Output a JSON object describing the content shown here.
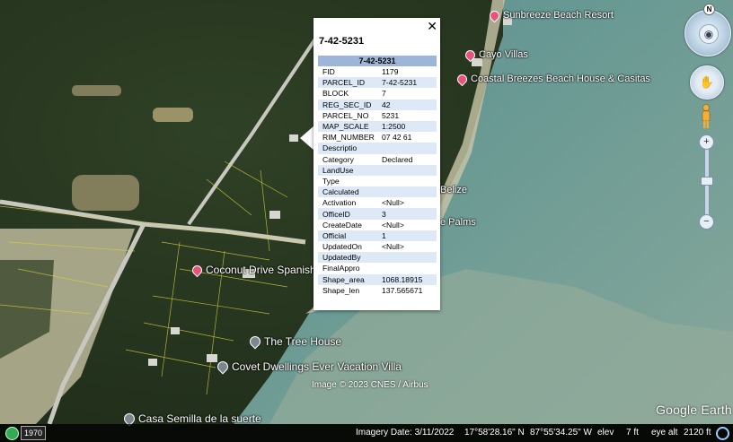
{
  "app": {
    "name": "Google Earth",
    "copyright": "Image © 2023 CNES / Airbus"
  },
  "places": [
    {
      "label": "Sunbreeze Beach Resort",
      "icon": "pink-pin"
    },
    {
      "label": "Cayo Villas",
      "icon": "pink-pin"
    },
    {
      "label": "Coastal Breezes Beach House & Casitas",
      "icon": "pink-pin"
    },
    {
      "label": "Belize",
      "icon": "none"
    },
    {
      "label": "e Palms",
      "icon": "none"
    },
    {
      "label": "Coconut Drive Spanish Re",
      "icon": "pink-pin"
    },
    {
      "label": "The Tree House",
      "icon": "grey-pin"
    },
    {
      "label": "Covet Dwellings Ever Vacation Villa",
      "icon": "grey-pin"
    },
    {
      "label": "Casa Semilla de la suerte",
      "icon": "grey-pin"
    }
  ],
  "popup": {
    "title": "7-42-5231",
    "close_glyph": "✕",
    "table_header": "7-42-5231",
    "rows": [
      {
        "key": "FID",
        "value": "1179"
      },
      {
        "key": "PARCEL_ID",
        "value": "7-42-5231"
      },
      {
        "key": "BLOCK",
        "value": "7"
      },
      {
        "key": "REG_SEC_ID",
        "value": "42"
      },
      {
        "key": "PARCEL_NO",
        "value": "5231"
      },
      {
        "key": "MAP_SCALE",
        "value": "1:2500"
      },
      {
        "key": "RIM_NUMBER",
        "value": "07 42 61"
      },
      {
        "key": "Descriptio",
        "value": ""
      },
      {
        "key": "Category",
        "value": "Declared"
      },
      {
        "key": "LandUse",
        "value": ""
      },
      {
        "key": "Type",
        "value": ""
      },
      {
        "key": "Calculated",
        "value": ""
      },
      {
        "key": "Activation",
        "value": "<Null>"
      },
      {
        "key": "OfficeID",
        "value": "3"
      },
      {
        "key": "CreateDate",
        "value": "<Null>"
      },
      {
        "key": "Official",
        "value": "1"
      },
      {
        "key": "UpdatedOn",
        "value": "<Null>"
      },
      {
        "key": "UpdatedBy",
        "value": ""
      },
      {
        "key": "FinalAppro",
        "value": ""
      },
      {
        "key": "Shape_area",
        "value": "1068.18915"
      },
      {
        "key": "Shape_len",
        "value": "137.565671"
      }
    ]
  },
  "navigation": {
    "north_label": "N",
    "zoom_in": "+",
    "zoom_out": "−",
    "look_icon": "eye-icon",
    "move_icon": "hand-icon",
    "street_view_icon": "pegman-icon"
  },
  "status_bar": {
    "year": "1970",
    "imagery_date": "Imagery Date: 3/11/2022",
    "latitude": "17°58'28.16\" N",
    "longitude": "87°55'34.25\" W",
    "elev_label": "elev",
    "elev_value": "7 ft",
    "eye_alt_label": "eye alt",
    "eye_alt_value": "2120 ft"
  },
  "colors": {
    "sea": "#6f9a92",
    "shallow_sea": "#8aa89a",
    "land": "#2c3a22",
    "table_header": "#9db5d6",
    "table_alt_row": "#dde9f7"
  }
}
